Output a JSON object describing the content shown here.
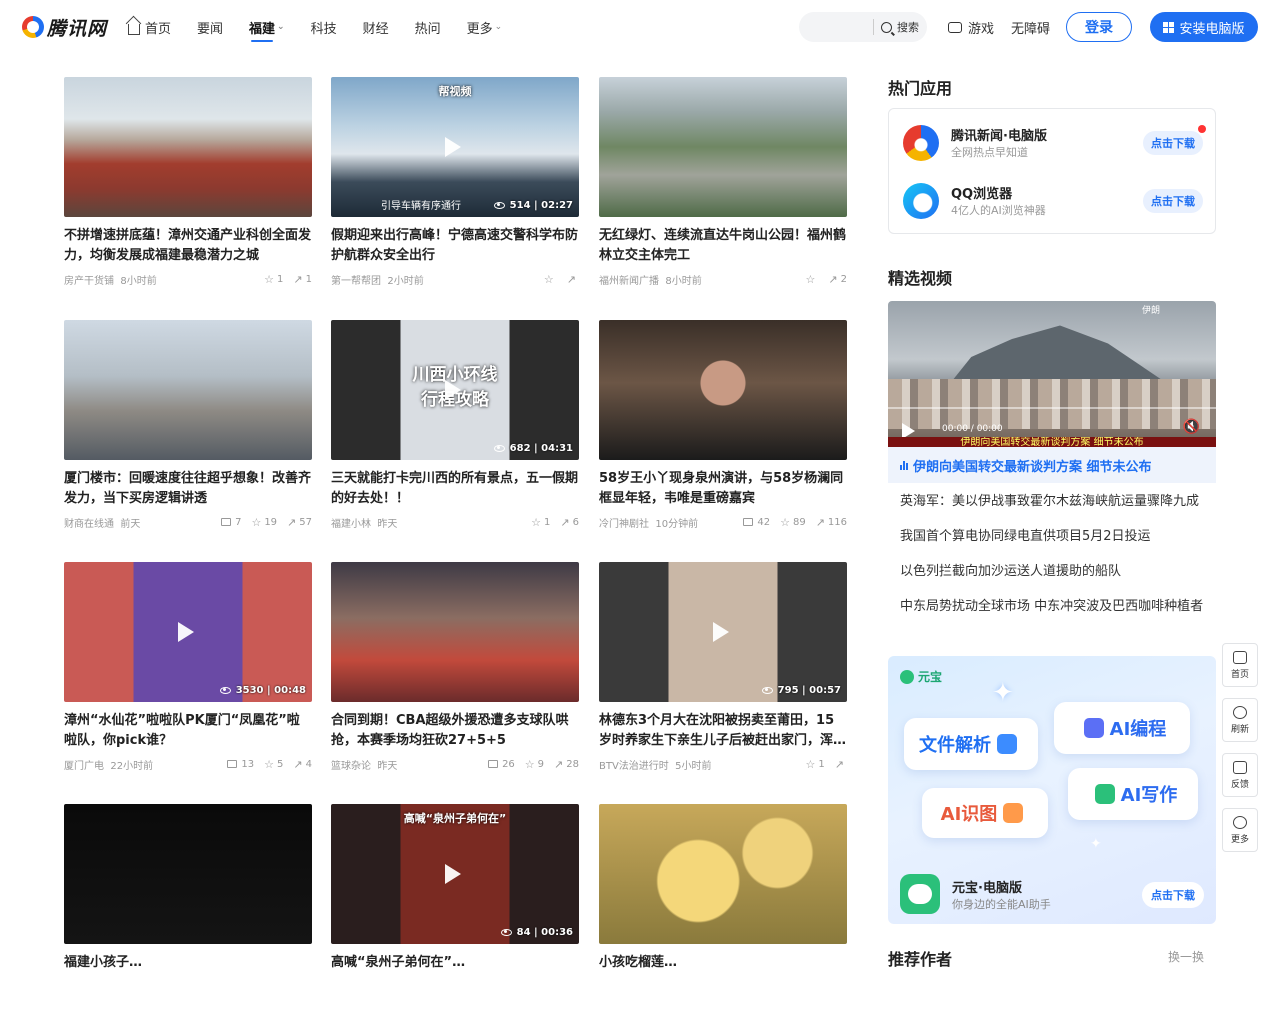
{
  "header": {
    "logo_text": "腾讯网",
    "nav": [
      {
        "label": "首页"
      },
      {
        "label": "要闻"
      },
      {
        "label": "福建"
      },
      {
        "label": "科技"
      },
      {
        "label": "财经"
      },
      {
        "label": "热问"
      },
      {
        "label": "更多"
      }
    ],
    "search_placeholder": "",
    "search_label": "搜索",
    "games_label": "游戏",
    "accessibility_label": "无障碍",
    "login_label": "登录",
    "install_label": "安装电脑版",
    "accent_color": "#1f6ff2"
  },
  "feed": [
    {
      "title": "不拼增速拼底蕴！漳州交通产业科创全面发力，均衡发展成福建最稳潜力之城",
      "source": "房产干货铺",
      "time": "8小时前",
      "comments": "",
      "likes": "1",
      "shares": "1",
      "video": false,
      "views": "",
      "duration": "",
      "thumb": "city-rooftops"
    },
    {
      "title": "假期迎来出行高峰！宁德高速交警科学布防护航群众安全出行",
      "source": "第一帮帮团",
      "time": "2小时前",
      "comments": "",
      "likes": "",
      "shares": "",
      "video": true,
      "views": "514",
      "duration": "02:27",
      "thumb": "traffic-police",
      "overlay": "帮视频",
      "caption": "引导车辆有序通行"
    },
    {
      "title": "无红绿灯、连续流直达牛岗山公园！福州鹤林立交主体完工",
      "source": "福州新闻广播",
      "time": "8小时前",
      "comments": "",
      "likes": "",
      "shares": "2",
      "video": false,
      "views": "",
      "duration": "",
      "thumb": "interchange"
    },
    {
      "title": "厦门楼市：回暖速度往往超乎想象！改善齐发力，当下买房逻辑讲透",
      "source": "财商在线通",
      "time": "前天",
      "comments": "7",
      "likes": "19",
      "shares": "57",
      "video": false,
      "views": "",
      "duration": "",
      "thumb": "street-tower"
    },
    {
      "title": "三天就能打卡完川西的所有景点，五一假期的好去处！！",
      "source": "福建小林",
      "time": "昨天",
      "comments": "",
      "likes": "1",
      "shares": "6",
      "video": true,
      "views": "682",
      "duration": "04:31",
      "thumb": "mountain-text",
      "overlay": "川西小环线\n行程攻略"
    },
    {
      "title": "58岁王小丫现身泉州演讲，与58岁杨澜同框显年轻，韦唯是重磅嘉宾",
      "source": "冷门神剧社",
      "time": "10分钟前",
      "comments": "42",
      "likes": "89",
      "shares": "116",
      "video": false,
      "views": "",
      "duration": "",
      "thumb": "portrait"
    },
    {
      "title": "漳州“水仙花”啦啦队PK厦门“凤凰花”啦啦队，你pick谁？",
      "source": "厦门广电",
      "time": "22小时前",
      "comments": "13",
      "likes": "5",
      "shares": "4",
      "video": true,
      "views": "3530",
      "duration": "00:48",
      "thumb": "cheer"
    },
    {
      "title": "合同到期！CBA超级外援恐遭多支球队哄抢，本赛季场均狂砍27+5+5",
      "source": "篮球杂论",
      "time": "昨天",
      "comments": "26",
      "likes": "9",
      "shares": "28",
      "video": false,
      "views": "",
      "duration": "",
      "thumb": "basketball"
    },
    {
      "title": "林德东3个月大在沈阳被拐卖至莆田，15岁时养家生下亲生儿子后被赶出家门，浑身…",
      "source": "BTV法治进行时",
      "time": "5小时前",
      "comments": "",
      "likes": "1",
      "shares": "",
      "video": true,
      "views": "795",
      "duration": "00:57",
      "thumb": "man-video"
    },
    {
      "title": "福建小孩子…",
      "source": "",
      "time": "",
      "comments": "",
      "likes": "",
      "shares": "",
      "video": false,
      "views": "",
      "duration": "",
      "thumb": "dark"
    },
    {
      "title": "高喊“泉州子弟何在”…",
      "source": "",
      "time": "",
      "comments": "",
      "likes": "",
      "shares": "",
      "video": true,
      "views": "84",
      "duration": "00:36",
      "thumb": "warrior",
      "overlay": "高喊“泉州子弟何在”"
    },
    {
      "title": "小孩吃榴莲…",
      "source": "",
      "time": "",
      "comments": "",
      "likes": "",
      "shares": "",
      "video": false,
      "views": "",
      "duration": "",
      "thumb": "durian"
    }
  ],
  "sidebar": {
    "hot_apps_title": "热门应用",
    "apps": [
      {
        "name": "腾讯新闻·电脑版",
        "sub": "全网热点早知道",
        "button": "点击下载"
      },
      {
        "name": "QQ浏览器",
        "sub": "4亿人的AI浏览神器",
        "button": "点击下载"
      }
    ],
    "videos_title": "精选视频",
    "video_time": "00:00 / 00:00",
    "video_channel": "伊朗",
    "video_caption": "伊朗向美国转交最新谈判方案 细节未公布",
    "video_headline": "伊朗向美国转交最新谈判方案 细节未公布",
    "video_list": [
      "英海军：美以伊战事致霍尔木兹海峡航运量骤降九成",
      "我国首个算电协同绿电直供项目5月2日投运",
      "以色列拦截向加沙运送人道援助的船队",
      "中东局势扰动全球市场 中东冲突波及巴西咖啡种植者"
    ],
    "yuanbao": {
      "brand": "元宝",
      "features": [
        "文件解析",
        "AI编程",
        "AI写作",
        "AI识图"
      ],
      "name": "元宝·电脑版",
      "sub": "你身边的全能AI助手",
      "button": "点击下载"
    },
    "authors_title": "推荐作者",
    "authors_more": "换一换"
  },
  "float_bar": [
    {
      "label": "首页"
    },
    {
      "label": "刷新"
    },
    {
      "label": "反馈"
    },
    {
      "label": "更多"
    }
  ]
}
